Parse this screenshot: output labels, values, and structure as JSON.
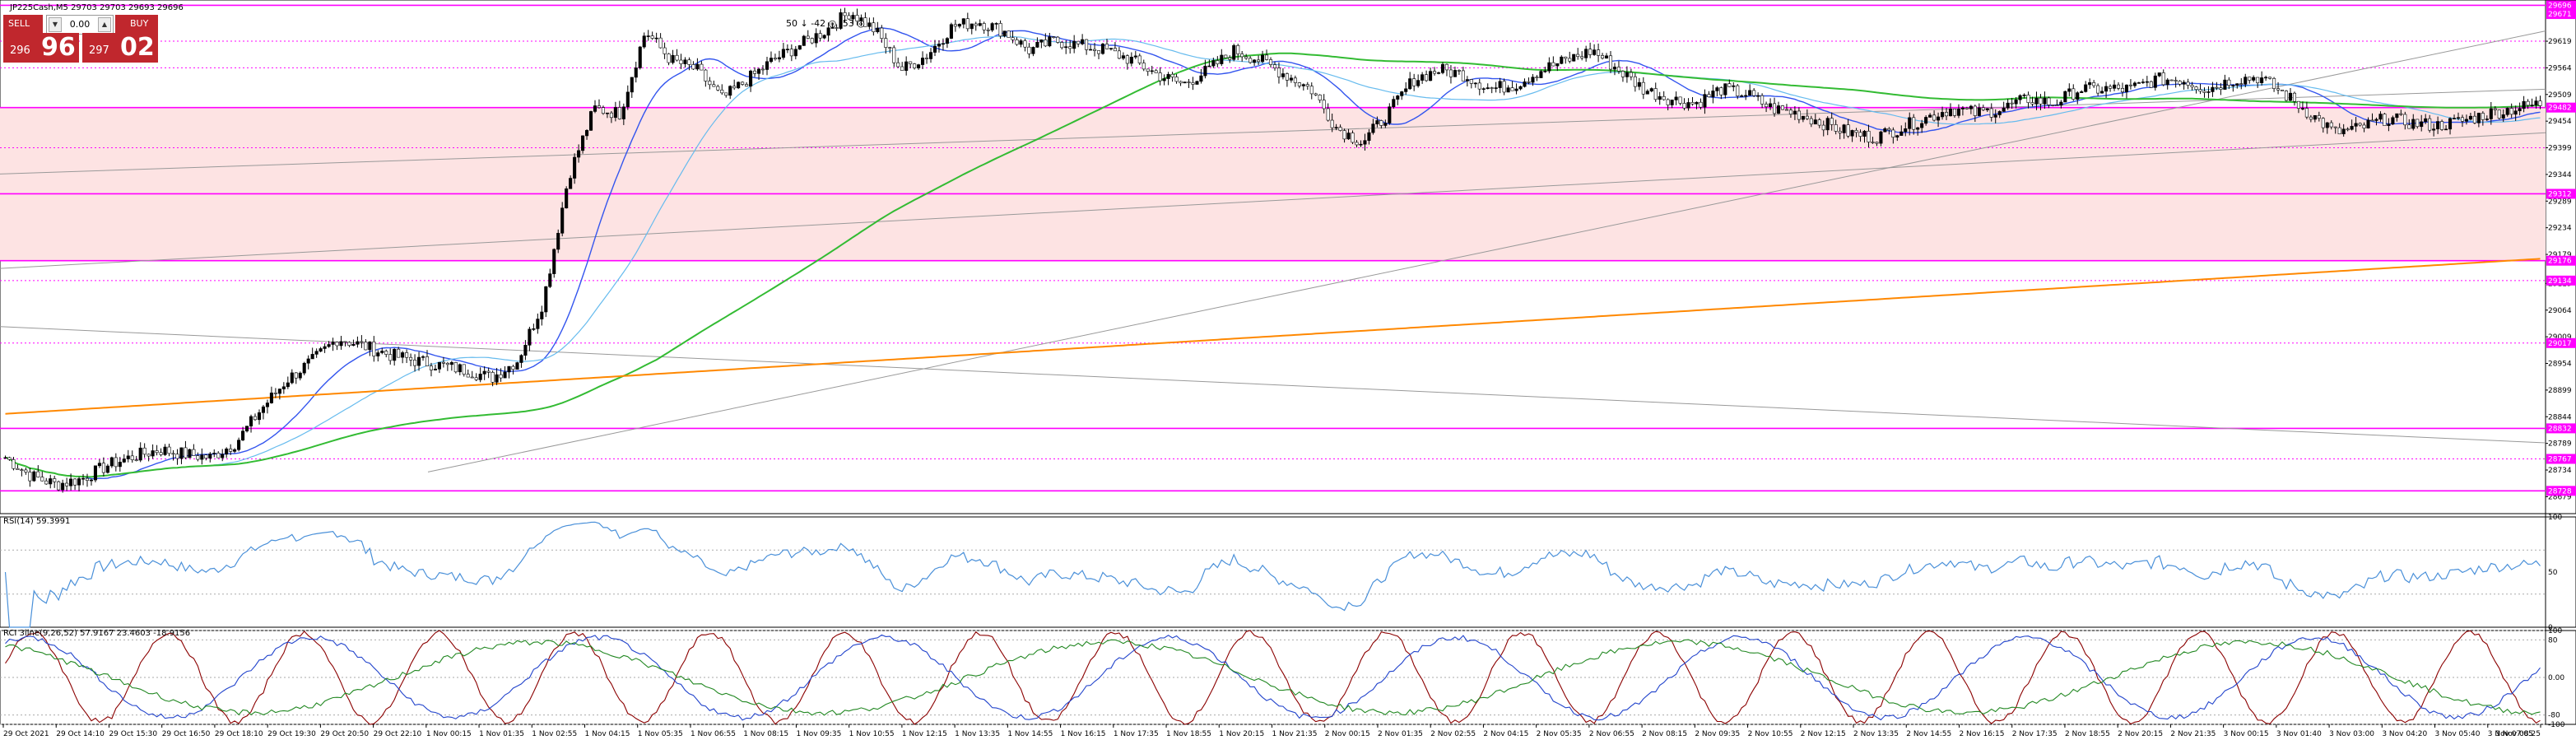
{
  "window": {
    "title": "JP225Cash,M5  29703 29703 29693 29696"
  },
  "trade_panel": {
    "sell_label": "SELL",
    "buy_label": "BUY",
    "lot_value": "0.00",
    "sell_price_small": "296",
    "sell_price_big": "96",
    "buy_price_small": "297",
    "buy_price_big": "02"
  },
  "chart_annotation": "50 ↓ -42 ◎ -53 ◎",
  "rsi_label": "RSI(14) 59.3991",
  "rci_label": "RCI 3line(9,26,52) 57.9167 23.4603 -18.9156",
  "rci_levels": [
    {
      "label": "100",
      "value": 100
    },
    {
      "label": "80",
      "value": 80
    },
    {
      "label": "0.00",
      "value": 0
    },
    {
      "label": "-80",
      "value": -80
    },
    {
      "label": "-100",
      "value": -100
    }
  ],
  "colors": {
    "bull": "#000000",
    "bear": "#ffffff",
    "zone": "#fde3e3",
    "magenta": "#ff00ff",
    "ma_green": "#33bb33",
    "ma_orange": "#ff8800",
    "ma_blue": "#3355ee",
    "ma_lightblue": "#66bbee",
    "rsi_line": "#4a90d9",
    "rci_short": "#8b0000",
    "rci_mid": "#2244cc",
    "rci_long": "#228822"
  },
  "chart_data": {
    "type": "candlestick",
    "symbol": "JP225Cash",
    "timeframe": "M5",
    "ylim": [
      28644,
      29704
    ],
    "y_ticks": [
      "29619",
      "29564",
      "29509",
      "29454",
      "29399",
      "29344",
      "29289",
      "29234",
      "29179",
      "29119",
      "29064",
      "29009",
      "28954",
      "28899",
      "28844",
      "28789",
      "28734",
      "28679"
    ],
    "price_labels": [
      {
        "value": 29693,
        "text": "29696"
      },
      {
        "value": 29675,
        "text": "29671"
      },
      {
        "value": 29482,
        "text": "29482"
      },
      {
        "value": 29304,
        "text": "29312"
      },
      {
        "value": 29166,
        "text": "29176"
      },
      {
        "value": 29125,
        "text": "29134"
      },
      {
        "value": 28996,
        "text": "29017"
      },
      {
        "value": 28820,
        "text": "28832"
      },
      {
        "value": 28757,
        "text": "28767"
      },
      {
        "value": 28691,
        "text": "28728"
      }
    ],
    "solid_levels": [
      29693,
      29482,
      29304,
      29166,
      28820,
      28691
    ],
    "dotted_levels": [
      29619,
      29564,
      29399,
      29125,
      28996,
      28757
    ],
    "zone": [
      29166,
      29482
    ],
    "x_labels": [
      "29 Oct 2021",
      "29 Oct 14:10",
      "29 Oct 15:30",
      "29 Oct 16:50",
      "29 Oct 18:10",
      "29 Oct 19:30",
      "29 Oct 20:50",
      "29 Oct 22:10",
      "1 Nov 00:15",
      "1 Nov 01:35",
      "1 Nov 02:55",
      "1 Nov 04:15",
      "1 Nov 05:35",
      "1 Nov 06:55",
      "1 Nov 08:15",
      "1 Nov 09:35",
      "1 Nov 10:55",
      "1 Nov 12:15",
      "1 Nov 13:35",
      "1 Nov 14:55",
      "1 Nov 16:15",
      "1 Nov 17:35",
      "1 Nov 18:55",
      "1 Nov 20:15",
      "1 Nov 21:35",
      "2 Nov 00:15",
      "2 Nov 01:35",
      "2 Nov 02:55",
      "2 Nov 04:15",
      "2 Nov 05:35",
      "2 Nov 06:55",
      "2 Nov 08:15",
      "2 Nov 09:35",
      "2 Nov 10:55",
      "2 Nov 12:15",
      "2 Nov 13:35",
      "2 Nov 14:55",
      "2 Nov 16:15",
      "2 Nov 17:35",
      "2 Nov 18:55",
      "2 Nov 20:15",
      "2 Nov 21:35",
      "3 Nov 00:15",
      "3 Nov 01:40",
      "3 Nov 03:00",
      "3 Nov 04:20",
      "3 Nov 05:40",
      "3 Nov 07:05",
      "3 Nov 08:25"
    ],
    "candles_anchor_closes": [
      28760,
      28722,
      28704,
      28716,
      28744,
      28762,
      28776,
      28767,
      28760,
      28790,
      28860,
      28920,
      28960,
      29006,
      28990,
      28972,
      28960,
      28950,
      28940,
      28924,
      28960,
      29080,
      29340,
      29480,
      29470,
      29640,
      29580,
      29560,
      29500,
      29540,
      29580,
      29610,
      29640,
      29680,
      29640,
      29560,
      29590,
      29650,
      29660,
      29640,
      29600,
      29620,
      29610,
      29600,
      29580,
      29550,
      29530,
      29560,
      29600,
      29580,
      29550,
      29520,
      29440,
      29410,
      29470,
      29540,
      29560,
      29550,
      29520,
      29530,
      29560,
      29580,
      29600,
      29560,
      29520,
      29500,
      29490,
      29520,
      29510,
      29480,
      29470,
      29450,
      29430,
      29420,
      29440,
      29460,
      29480,
      29470,
      29480,
      29500,
      29490,
      29520,
      29520,
      29520,
      29540,
      29540,
      29520,
      29540,
      29545,
      29510,
      29470,
      29430,
      29440,
      29460,
      29450,
      29445,
      29455,
      29470,
      29480,
      29490
    ],
    "rsi": {
      "name": "RSI(14)",
      "levels": [
        70,
        30
      ],
      "ylim": [
        0,
        100
      ]
    },
    "rci": {
      "ylim": [
        -100,
        100
      ]
    }
  }
}
